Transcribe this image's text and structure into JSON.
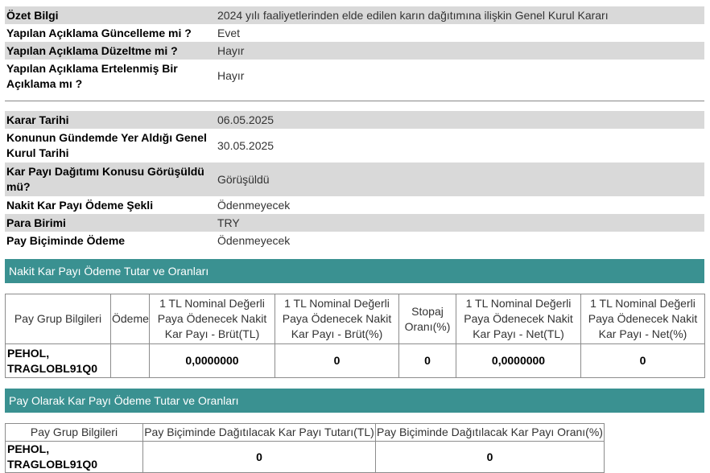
{
  "summary": {
    "rows": [
      {
        "label": "Özet Bilgi",
        "value": "2024 yılı faaliyetlerinden elde edilen karın dağıtımına ilişkin Genel Kurul Kararı"
      },
      {
        "label": "Yapılan Açıklama Güncelleme mi ?",
        "value": "Evet"
      },
      {
        "label": "Yapılan Açıklama Düzeltme mi ?",
        "value": "Hayır"
      },
      {
        "label": "Yapılan Açıklama Ertelenmiş Bir Açıklama mı ?",
        "value": "Hayır"
      }
    ]
  },
  "details": {
    "rows": [
      {
        "label": "Karar Tarihi",
        "value": "06.05.2025"
      },
      {
        "label": "Konunun Gündemde Yer Aldığı Genel Kurul Tarihi",
        "value": "30.05.2025"
      },
      {
        "label": "Kar Payı Dağıtımı Konusu Görüşüldü mü?",
        "value": "Görüşüldü"
      },
      {
        "label": "Nakit Kar Payı Ödeme Şekli",
        "value": "Ödenmeyecek"
      },
      {
        "label": "Para Birimi",
        "value": "TRY"
      },
      {
        "label": "Pay Biçiminde Ödeme",
        "value": "Ödenmeyecek"
      }
    ]
  },
  "cash_section": {
    "title": "Nakit Kar Payı Ödeme Tutar ve Oranları",
    "headers": [
      "Pay Grup Bilgileri",
      "Ödeme",
      "1 TL Nominal Değerli Paya Ödenecek Nakit Kar Payı - Brüt(TL)",
      "1 TL Nominal Değerli Paya Ödenecek Nakit Kar Payı - Brüt(%)",
      "Stopaj Oranı(%)",
      "1 TL Nominal Değerli Paya Ödenecek Nakit Kar Payı - Net(TL)",
      "1 TL Nominal Değerli Paya Ödenecek Nakit Kar Payı - Net(%)"
    ],
    "row": [
      "PEHOL, TRAGLOBL91Q0",
      "",
      "0,0000000",
      "0",
      "0",
      "0,0000000",
      "0"
    ]
  },
  "stock_section": {
    "title": "Pay Olarak Kar Payı Ödeme Tutar ve Oranları",
    "headers": [
      "Pay Grup Bilgileri",
      "Pay Biçiminde Dağıtılacak Kar Payı Tutarı(TL)",
      "Pay Biçiminde Dağıtılacak Kar Payı Oranı(%)"
    ],
    "row": [
      "PEHOL, TRAGLOBL91Q0",
      "0",
      "0"
    ]
  }
}
